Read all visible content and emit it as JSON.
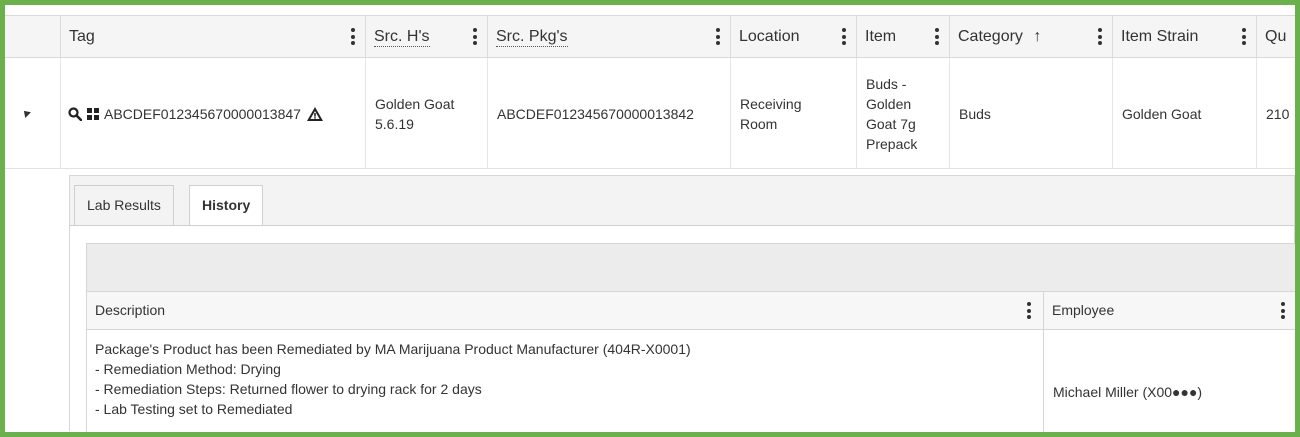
{
  "columns": [
    {
      "label": "Tag"
    },
    {
      "label": "Src. H's"
    },
    {
      "label": "Src. Pkg's"
    },
    {
      "label": "Location"
    },
    {
      "label": "Item"
    },
    {
      "label": "Category"
    },
    {
      "label": "Item Strain"
    },
    {
      "label": "Qu"
    }
  ],
  "sort_arrow": "↑",
  "row": {
    "tag": "ABCDEF012345670000013847",
    "src_h": [
      "Golden Goat",
      "5.6.19"
    ],
    "src_pkg": "ABCDEF012345670000013842",
    "location": [
      "Receiving",
      "Room"
    ],
    "item": [
      "Buds -",
      "Golden",
      "Goat 7g",
      "Prepack"
    ],
    "category": "Buds",
    "item_strain": "Golden Goat",
    "quantity": "210"
  },
  "tabs": [
    {
      "label": "Lab Results"
    },
    {
      "label": "History"
    }
  ],
  "history": {
    "columns": [
      {
        "label": "Description"
      },
      {
        "label": "Employee"
      }
    ],
    "description_lines": [
      "Package's Product has been Remediated by MA Marijuana Product Manufacturer (404R-X0001)",
      "- Remediation Method: Drying",
      "- Remediation Steps: Returned flower to drying rack for 2 days",
      "- Lab Testing set to Remediated"
    ],
    "employee": "Michael Miller (X00●●●)"
  },
  "icons": {
    "search": "search-icon",
    "grid": "grid-icon",
    "warning": "warning-icon",
    "expand": "collapse-caret-icon"
  },
  "colors": {
    "frame": "#6ab04c",
    "header_bg": "#f5f5f5"
  }
}
